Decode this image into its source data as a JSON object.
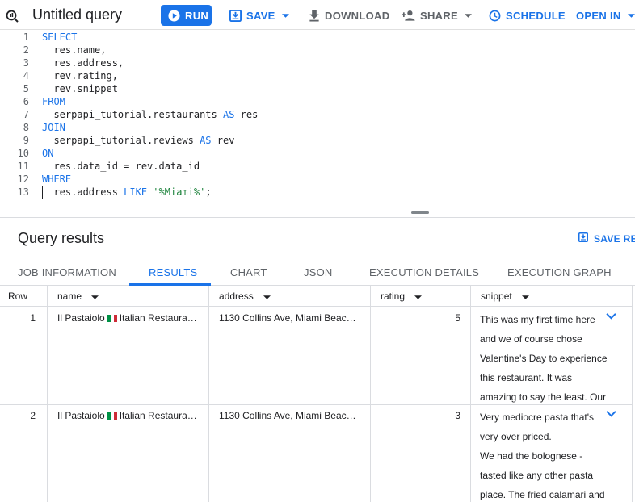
{
  "toolbar": {
    "title": "Untitled query",
    "run_label": "RUN",
    "save_label": "SAVE",
    "download_label": "DOWNLOAD",
    "share_label": "SHARE",
    "schedule_label": "SCHEDULE",
    "open_in_label": "OPEN IN"
  },
  "editor": {
    "line_numbers": [
      "1",
      "2",
      "3",
      "4",
      "5",
      "6",
      "7",
      "8",
      "9",
      "10",
      "11",
      "12",
      "13"
    ],
    "lines": [
      [
        {
          "t": "SELECT",
          "c": "kw"
        }
      ],
      [
        {
          "t": "  res.name,",
          "c": ""
        }
      ],
      [
        {
          "t": "  res.address,",
          "c": ""
        }
      ],
      [
        {
          "t": "  rev.rating,",
          "c": ""
        }
      ],
      [
        {
          "t": "  rev.snippet",
          "c": ""
        }
      ],
      [
        {
          "t": "FROM",
          "c": "kw"
        }
      ],
      [
        {
          "t": "  serpapi_tutorial.restaurants ",
          "c": ""
        },
        {
          "t": "AS",
          "c": "kw"
        },
        {
          "t": " res",
          "c": ""
        }
      ],
      [
        {
          "t": "JOIN",
          "c": "kw"
        }
      ],
      [
        {
          "t": "  serpapi_tutorial.reviews ",
          "c": ""
        },
        {
          "t": "AS",
          "c": "kw"
        },
        {
          "t": " rev",
          "c": ""
        }
      ],
      [
        {
          "t": "ON",
          "c": "kw"
        }
      ],
      [
        {
          "t": "  res.data_id = rev.data_id",
          "c": ""
        }
      ],
      [
        {
          "t": "WHERE",
          "c": "kw"
        }
      ],
      [
        {
          "t": "  res.address ",
          "c": ""
        },
        {
          "t": "LIKE",
          "c": "kw"
        },
        {
          "t": " ",
          "c": ""
        },
        {
          "t": "'%Miami%'",
          "c": "str"
        },
        {
          "t": ";",
          "c": ""
        }
      ]
    ]
  },
  "results": {
    "title": "Query results",
    "save_results_label": "SAVE RE"
  },
  "tabs": {
    "job_information": "JOB INFORMATION",
    "results": "RESULTS",
    "chart": "CHART",
    "json": "JSON",
    "execution_details": "EXECUTION DETAILS",
    "execution_graph": "EXECUTION GRAPH"
  },
  "table": {
    "headers": {
      "row": "Row",
      "name": "name",
      "address": "address",
      "rating": "rating",
      "snippet": "snippet"
    },
    "rows": [
      {
        "row": "1",
        "name_a": "Il Pastaiolo",
        "name_b": "Italian Restauran…",
        "address": "1130 Collins Ave, Miami Beach,…",
        "rating": "5",
        "snippet": "This was my first time here and we of course chose Valentine's Day to experience this restaurant. It was amazing to say the least. Our"
      },
      {
        "row": "2",
        "name_a": "Il Pastaiolo",
        "name_b": "Italian Restauran…",
        "address": "1130 Collins Ave, Miami Beach,…",
        "rating": "3",
        "snippet_1": "Very mediocre pasta that's very over priced.",
        "snippet_2": "We had the bolognese - tasted like any other pasta place. The fried calamari and shrimp was"
      }
    ]
  },
  "colors": {
    "accent": "#1a73e8",
    "keyword": "#1a73e8",
    "string": "#188038"
  }
}
